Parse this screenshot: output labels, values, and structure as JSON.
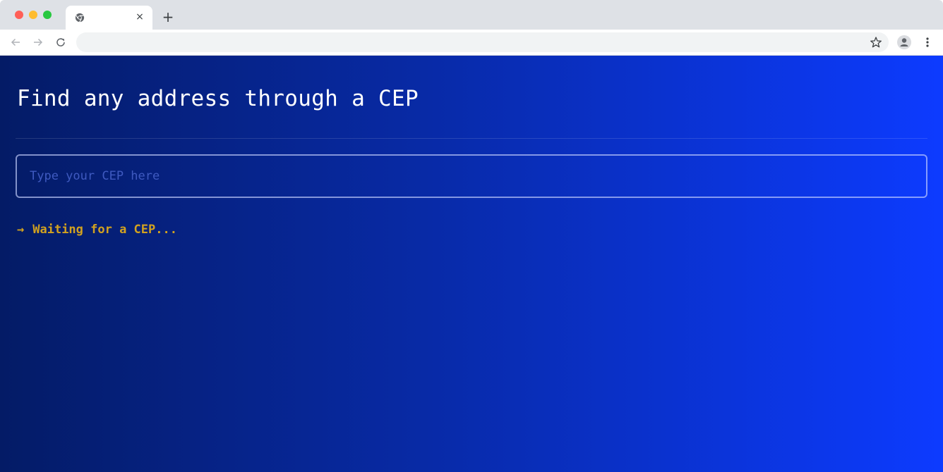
{
  "browser": {
    "tab": {
      "title": "",
      "close_glyph": "×"
    },
    "new_tab_glyph": "+",
    "address": {
      "url": ""
    },
    "colors": {
      "chrome": "#dee1e6",
      "omnibox": "#f1f3f4"
    },
    "icons": [
      "chrome-logo-icon",
      "back-arrow-icon",
      "forward-arrow-icon",
      "reload-icon",
      "star-icon",
      "profile-icon",
      "kebab-menu-icon"
    ]
  },
  "page": {
    "title": "Find any address through a CEP",
    "input": {
      "placeholder": "Type your CEP here",
      "value": ""
    },
    "status": {
      "arrow": "→",
      "text": "Waiting for a CEP..."
    },
    "colors": {
      "gradient_start": "#041b66",
      "gradient_end": "#0d3bff",
      "status": "#d2a21f"
    }
  }
}
